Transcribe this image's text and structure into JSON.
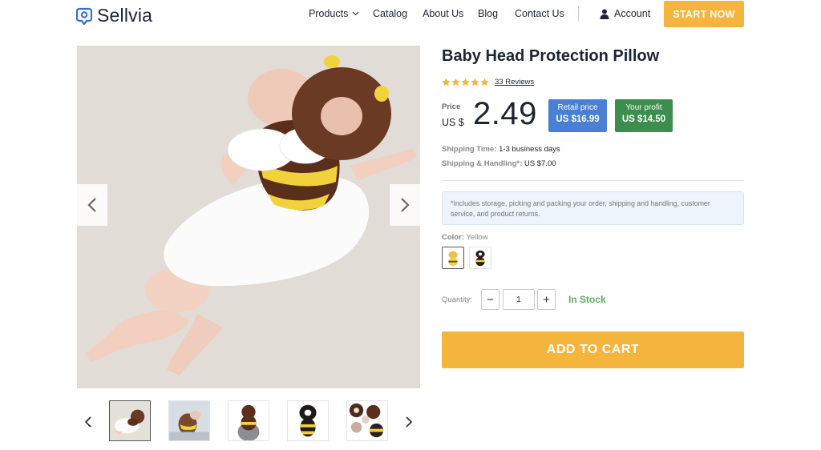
{
  "header": {
    "brand": "Sellvia",
    "nav": {
      "products": "Products",
      "catalog": "Catalog",
      "about": "About Us",
      "blog": "Blog",
      "contact": "Contact Us"
    },
    "account": "Account",
    "start_now": "START NOW"
  },
  "product": {
    "title": "Baby Head Protection Pillow",
    "rating": 5,
    "reviews": "33 Reviews",
    "price_label": "Price",
    "currency": "US $",
    "price": "2.49",
    "retail": {
      "label": "Retail price",
      "value": "US $16.99"
    },
    "profit": {
      "label": "Your profit",
      "value": "US $14.50"
    },
    "shipping_time": {
      "label": "Shipping Time:",
      "value": "1-3 business days"
    },
    "shipping_handling": {
      "label": "Shipping & Handling*:",
      "value": "US $7.00"
    },
    "note": "*Includes storage, picking and packing your order, shipping and handling, customer service, and product returns.",
    "color": {
      "label": "Color:",
      "value": "Yellow"
    },
    "quantity": {
      "label": "Quantity:",
      "minus": "−",
      "plus": "+",
      "value": "1"
    },
    "stock": "In Stock",
    "add_to_cart": "ADD TO CART"
  },
  "colors": {
    "brand_blue": "#2f6fd1",
    "accent_orange": "#f5b43c",
    "retail_blue": "#4a7fd6",
    "profit_green": "#3b8e4b",
    "stock_green": "#56b05e"
  },
  "icons": [
    "logo-pin-icon",
    "chevron-down-icon",
    "user-icon",
    "chevron-left-icon",
    "chevron-right-icon",
    "star-icon"
  ]
}
